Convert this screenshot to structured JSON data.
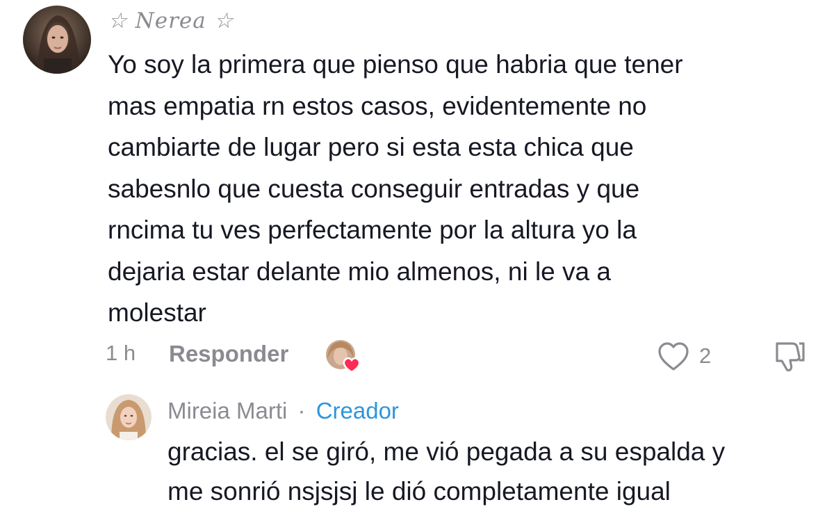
{
  "comment": {
    "username": "☆ Nerea ☆",
    "avatar_icon": "user-avatar-photo",
    "text_lines": [
      "Yo soy la primera que pienso que habria que tener",
      "mas empatia rn estos casos, evidentemente no",
      "cambiarte de lugar pero si esta esta chica que",
      "sabesnlo que cuesta conseguir entradas y que",
      "rncima tu ves perfectamente por la altura yo la",
      "dejaria estar delante mio almenos, ni le va a",
      "molestar"
    ],
    "time": "1 h",
    "reply_label": "Responder",
    "creator_liked_icon": "creator-liked-heart-avatar",
    "like_icon": "heart-outline-icon",
    "like_count": "2",
    "dislike_icon": "thumbs-down-icon"
  },
  "reply": {
    "username": "Mireia Marti",
    "separator": "·",
    "badge": "Creador",
    "avatar_icon": "user-avatar-photo",
    "text_lines": [
      "gracias. el se giró, me vió pegada a su espalda y",
      "me sonrió nsjsjsj le dió completamente igual"
    ]
  },
  "colors": {
    "text": "#161823",
    "muted": "#8a8b91",
    "creator_badge": "#2f95dc",
    "heart_red": "#fe2c55"
  }
}
